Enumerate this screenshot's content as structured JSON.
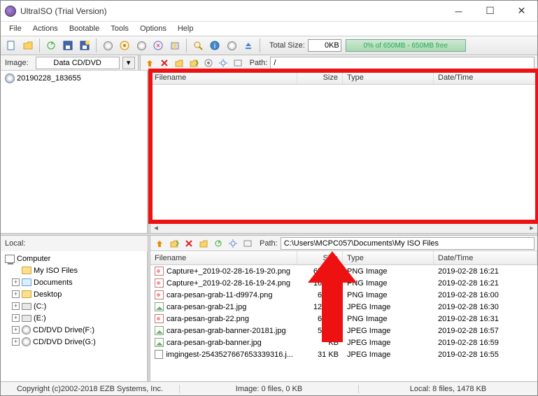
{
  "titlebar": {
    "title": "UltraISO (Trial Version)"
  },
  "menu": [
    "File",
    "Actions",
    "Bootable",
    "Tools",
    "Options",
    "Help"
  ],
  "size": {
    "total_label": "Total Size:",
    "total_value": "0KB",
    "free_text": "0% of 650MB - 650MB free"
  },
  "row2_top": {
    "image_label": "Image:",
    "image_value": "Data CD/DVD",
    "path_label": "Path:",
    "path_value": "/"
  },
  "top_tree_root": "20190228_183655",
  "columns": {
    "name": "Filename",
    "size": "Size",
    "type": "Type",
    "date": "Date/Time"
  },
  "local_label": "Local:",
  "row2_bottom": {
    "path_label": "Path:",
    "path_value": "C:\\Users\\MCPC057\\Documents\\My ISO Files"
  },
  "local_tree": {
    "root": "Computer",
    "items": [
      {
        "label": "My ISO Files",
        "icon": "folder"
      },
      {
        "label": "Documents",
        "icon": "docs"
      },
      {
        "label": "Desktop",
        "icon": "folder"
      },
      {
        "label": "(C:)",
        "icon": "drive"
      },
      {
        "label": "(E:)",
        "icon": "drive"
      },
      {
        "label": "CD/DVD Drive(F:)",
        "icon": "cd"
      },
      {
        "label": "CD/DVD Drive(G:)",
        "icon": "cd"
      }
    ]
  },
  "files": [
    {
      "name": "Capture+_2019-02-28-16-19-20.png",
      "size": "650 KB",
      "type": "PNG Image",
      "date": "2019-02-28 16:21",
      "icon": "png"
    },
    {
      "name": "Capture+_2019-02-28-16-19-24.png",
      "size": "161 KB",
      "type": "PNG Image",
      "date": "2019-02-28 16:21",
      "icon": "png"
    },
    {
      "name": "cara-pesan-grab-11-d9974.png",
      "size": "67 KB",
      "type": "PNG Image",
      "date": "2019-02-28 16:00",
      "icon": "png"
    },
    {
      "name": "cara-pesan-grab-21.jpg",
      "size": "124 KB",
      "type": "JPEG Image",
      "date": "2019-02-28 16:30",
      "icon": "jpg"
    },
    {
      "name": "cara-pesan-grab-22.png",
      "size": "67 KB",
      "type": "PNG Image",
      "date": "2019-02-28 16:31",
      "icon": "png"
    },
    {
      "name": "cara-pesan-grab-banner-20181.jpg",
      "size": "54 KB",
      "type": "JPEG Image",
      "date": "2019-02-28 16:57",
      "icon": "jpg"
    },
    {
      "name": "cara-pesan-grab-banner.jpg",
      "size": "KB",
      "type": "JPEG Image",
      "date": "2019-02-28 16:59",
      "icon": "jpg"
    },
    {
      "name": "imgingest-2543527667653339316.j...",
      "size": "31 KB",
      "type": "JPEG Image",
      "date": "2019-02-28 16:55",
      "icon": "img"
    }
  ],
  "status": {
    "copyright": "Copyright (c)2002-2018 EZB Systems, Inc.",
    "image": "Image: 0 files, 0 KB",
    "local": "Local: 8 files, 1478 KB"
  }
}
